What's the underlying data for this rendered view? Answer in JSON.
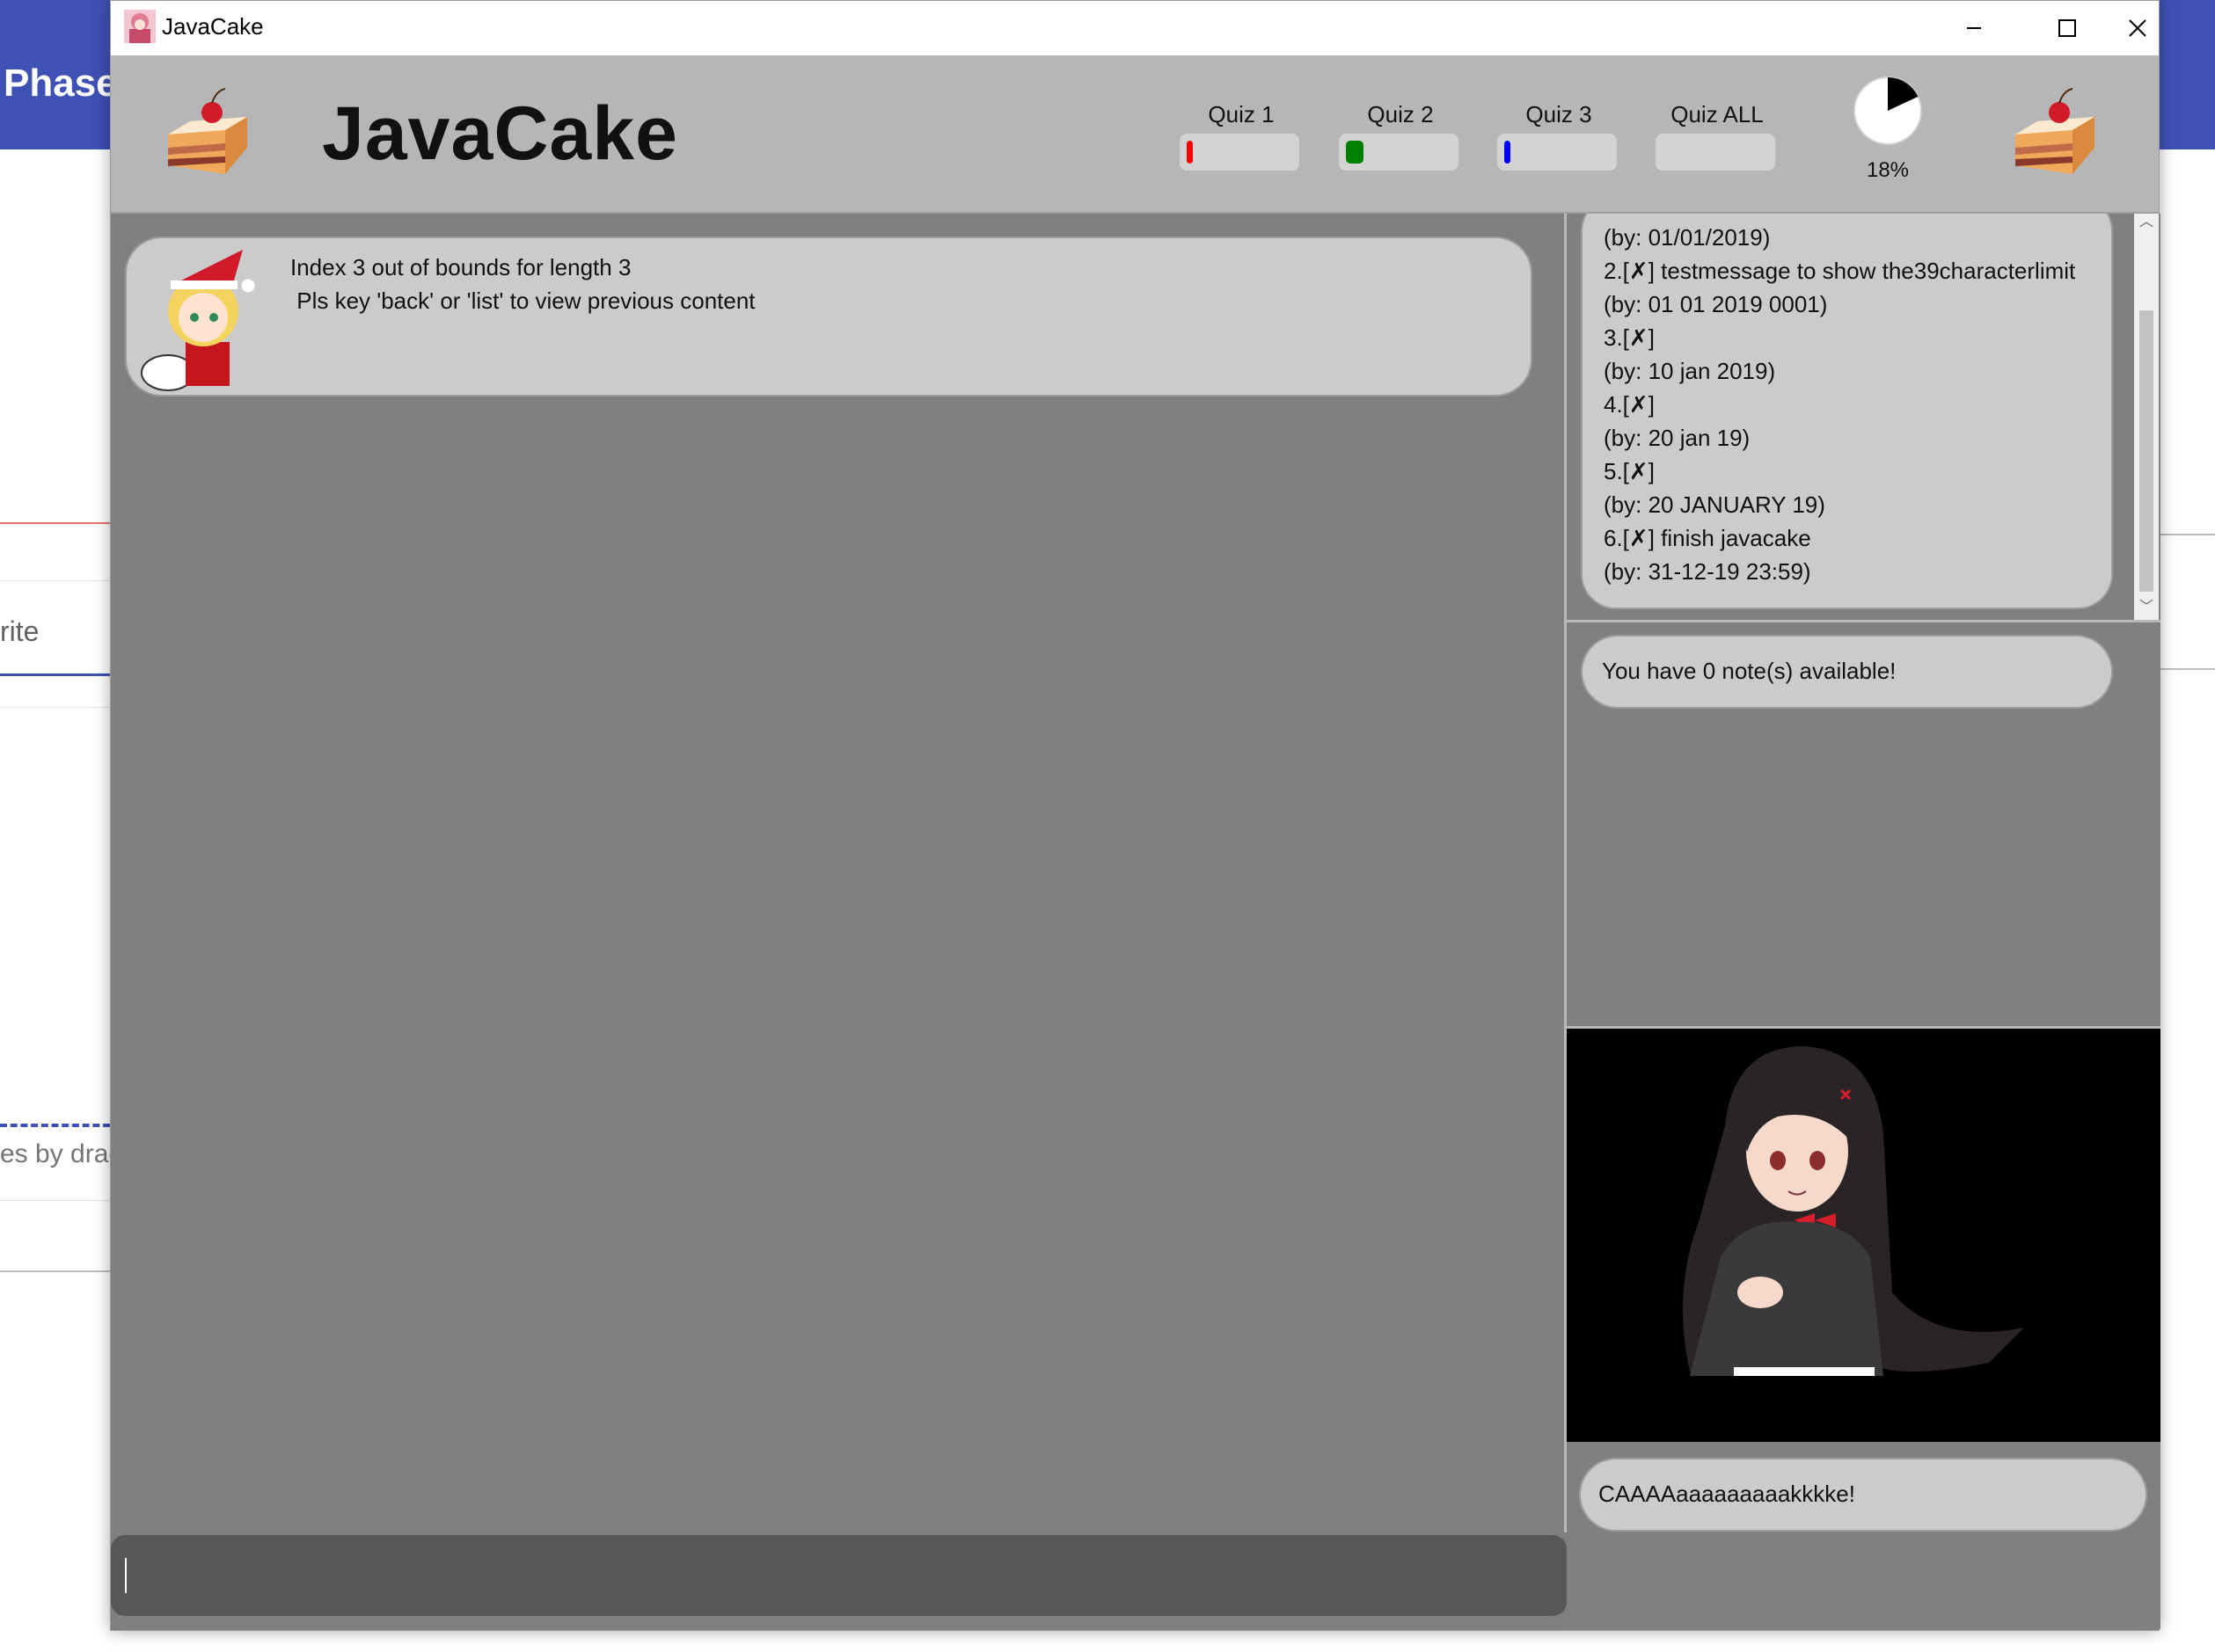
{
  "background_app": {
    "header_text": "Phase",
    "tab_text": "rite",
    "drag_text": "es by drag"
  },
  "window": {
    "title": "JavaCake",
    "controls": {
      "minimize": "minimize",
      "maximize": "maximize",
      "close": "close"
    }
  },
  "header": {
    "brand": "JavaCake",
    "quizzes": [
      {
        "label": "Quiz 1",
        "progress": 0.06,
        "color": "#ff0000"
      },
      {
        "label": "Quiz 2",
        "progress": 0.17,
        "color": "#008000"
      },
      {
        "label": "Quiz 3",
        "progress": 0.06,
        "color": "#0000ff"
      },
      {
        "label": "Quiz ALL",
        "progress": 0.0,
        "color": "#555555"
      }
    ],
    "overall_progress": {
      "label": "18%",
      "value": 0.18
    }
  },
  "chat": {
    "message_line1": "Index 3 out of bounds for length 3",
    "message_line2": " Pls key 'back' or 'list' to view previous content"
  },
  "input": {
    "value": ""
  },
  "deadlines": {
    "lines": [
      "(by: 01/01/2019)",
      "2.[✗] testmessage to show the39characterlimit",
      "(by: 01 01 2019 0001)",
      "3.[✗]",
      "(by: 10 jan 2019)",
      "4.[✗]",
      "(by: 20 jan 19)",
      "5.[✗]",
      "(by: 20 JANUARY 19)",
      "6.[✗] finish javacake",
      "(by: 31-12-19 23:59)"
    ]
  },
  "notes": {
    "text": "You have 0 note(s) available!"
  },
  "avatar_speech": {
    "text": "CAAAAaaaaaaaaakkkke!"
  }
}
